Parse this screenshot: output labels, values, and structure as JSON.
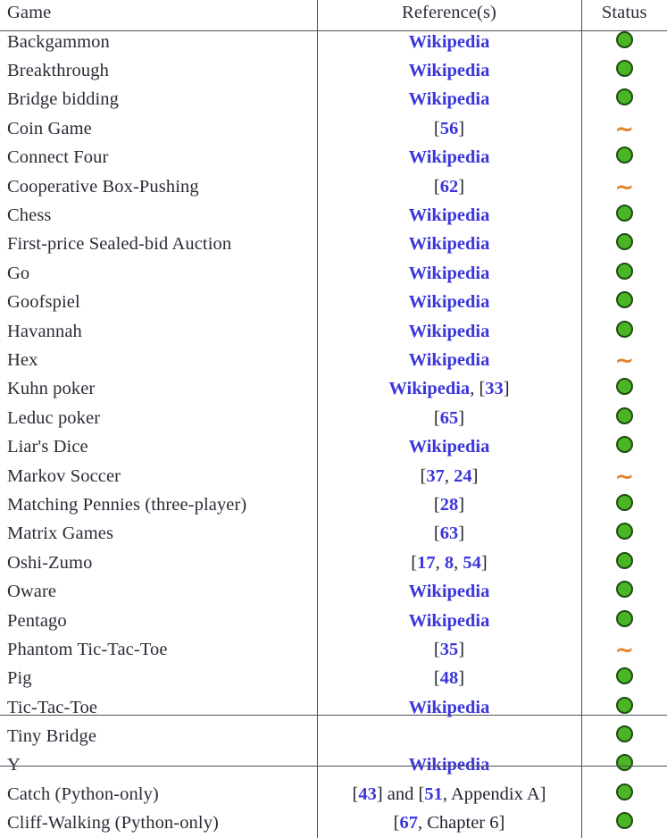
{
  "table": {
    "columns": [
      "Game",
      "Reference(s)",
      "Status"
    ],
    "status_legend": {
      "supported_icon": "green-circle-icon",
      "partial_icon": "orange-tilde-icon",
      "green_hex": "#4cb526",
      "orange_hex": "#e0862f",
      "link_hex": "#3b36d8"
    },
    "sections": [
      {
        "rows": [
          {
            "game": "Backgammon",
            "ref_parts": [
              {
                "text": "Wikipedia",
                "style": "link"
              }
            ],
            "status": "green-circle-icon"
          },
          {
            "game": "Breakthrough",
            "ref_parts": [
              {
                "text": "Wikipedia",
                "style": "link"
              }
            ],
            "status": "green-circle-icon"
          },
          {
            "game": "Bridge bidding",
            "ref_parts": [
              {
                "text": "Wikipedia",
                "style": "link"
              }
            ],
            "status": "green-circle-icon"
          },
          {
            "game": "Coin Game",
            "ref_parts": [
              {
                "text": "[",
                "style": "plain"
              },
              {
                "text": "56",
                "style": "link"
              },
              {
                "text": "]",
                "style": "plain"
              }
            ],
            "status": "orange-tilde-icon"
          },
          {
            "game": "Connect Four",
            "ref_parts": [
              {
                "text": "Wikipedia",
                "style": "link"
              }
            ],
            "status": "green-circle-icon"
          },
          {
            "game": "Cooperative Box-Pushing",
            "ref_parts": [
              {
                "text": "[",
                "style": "plain"
              },
              {
                "text": "62",
                "style": "link"
              },
              {
                "text": "]",
                "style": "plain"
              }
            ],
            "status": "orange-tilde-icon"
          },
          {
            "game": "Chess",
            "ref_parts": [
              {
                "text": "Wikipedia",
                "style": "link"
              }
            ],
            "status": "green-circle-icon"
          },
          {
            "game": "First-price Sealed-bid Auction",
            "ref_parts": [
              {
                "text": "Wikipedia",
                "style": "link"
              }
            ],
            "status": "green-circle-icon"
          },
          {
            "game": "Go",
            "ref_parts": [
              {
                "text": "Wikipedia",
                "style": "link"
              }
            ],
            "status": "green-circle-icon"
          },
          {
            "game": "Goofspiel",
            "ref_parts": [
              {
                "text": "Wikipedia",
                "style": "link"
              }
            ],
            "status": "green-circle-icon"
          },
          {
            "game": "Havannah",
            "ref_parts": [
              {
                "text": "Wikipedia",
                "style": "link"
              }
            ],
            "status": "green-circle-icon"
          },
          {
            "game": "Hex",
            "ref_parts": [
              {
                "text": "Wikipedia",
                "style": "link"
              }
            ],
            "status": "orange-tilde-icon"
          },
          {
            "game": "Kuhn poker",
            "ref_parts": [
              {
                "text": "Wikipedia",
                "style": "link"
              },
              {
                "text": ", [",
                "style": "plain"
              },
              {
                "text": "33",
                "style": "link"
              },
              {
                "text": "]",
                "style": "plain"
              }
            ],
            "status": "green-circle-icon"
          },
          {
            "game": "Leduc poker",
            "ref_parts": [
              {
                "text": "[",
                "style": "plain"
              },
              {
                "text": "65",
                "style": "link"
              },
              {
                "text": "]",
                "style": "plain"
              }
            ],
            "status": "green-circle-icon"
          },
          {
            "game": "Liar's Dice",
            "ref_parts": [
              {
                "text": "Wikipedia",
                "style": "link"
              }
            ],
            "status": "green-circle-icon"
          },
          {
            "game": "Markov Soccer",
            "ref_parts": [
              {
                "text": "[",
                "style": "plain"
              },
              {
                "text": "37",
                "style": "link"
              },
              {
                "text": ", ",
                "style": "plain"
              },
              {
                "text": "24",
                "style": "link"
              },
              {
                "text": "]",
                "style": "plain"
              }
            ],
            "status": "orange-tilde-icon"
          },
          {
            "game": "Matching Pennies (three-player)",
            "ref_parts": [
              {
                "text": "[",
                "style": "plain"
              },
              {
                "text": "28",
                "style": "link"
              },
              {
                "text": "]",
                "style": "plain"
              }
            ],
            "status": "green-circle-icon"
          },
          {
            "game": "Matrix Games",
            "ref_parts": [
              {
                "text": "[",
                "style": "plain"
              },
              {
                "text": "63",
                "style": "link"
              },
              {
                "text": "]",
                "style": "plain"
              }
            ],
            "status": "green-circle-icon"
          },
          {
            "game": "Oshi-Zumo",
            "ref_parts": [
              {
                "text": "[",
                "style": "plain"
              },
              {
                "text": "17",
                "style": "link"
              },
              {
                "text": ", ",
                "style": "plain"
              },
              {
                "text": "8",
                "style": "link"
              },
              {
                "text": ", ",
                "style": "plain"
              },
              {
                "text": "54",
                "style": "link"
              },
              {
                "text": "]",
                "style": "plain"
              }
            ],
            "status": "green-circle-icon"
          },
          {
            "game": "Oware",
            "ref_parts": [
              {
                "text": "Wikipedia",
                "style": "link"
              }
            ],
            "status": "green-circle-icon"
          },
          {
            "game": "Pentago",
            "ref_parts": [
              {
                "text": "Wikipedia",
                "style": "link"
              }
            ],
            "status": "green-circle-icon"
          },
          {
            "game": "Phantom Tic-Tac-Toe",
            "ref_parts": [
              {
                "text": "[",
                "style": "plain"
              },
              {
                "text": "35",
                "style": "link"
              },
              {
                "text": "]",
                "style": "plain"
              }
            ],
            "status": "orange-tilde-icon"
          },
          {
            "game": "Pig",
            "ref_parts": [
              {
                "text": "[",
                "style": "plain"
              },
              {
                "text": "48",
                "style": "link"
              },
              {
                "text": "]",
                "style": "plain"
              }
            ],
            "status": "green-circle-icon"
          },
          {
            "game": "Tic-Tac-Toe",
            "ref_parts": [
              {
                "text": "Wikipedia",
                "style": "link"
              }
            ],
            "status": "green-circle-icon"
          },
          {
            "game": "Tiny Bridge",
            "ref_parts": [],
            "status": "green-circle-icon"
          },
          {
            "game": "Y",
            "ref_parts": [
              {
                "text": "Wikipedia",
                "style": "link"
              }
            ],
            "status": "green-circle-icon"
          }
        ]
      },
      {
        "rows": [
          {
            "game": "Catch (Python-only)",
            "ref_parts": [
              {
                "text": "[",
                "style": "plain"
              },
              {
                "text": "43",
                "style": "link"
              },
              {
                "text": "] and [",
                "style": "plain"
              },
              {
                "text": "51",
                "style": "link"
              },
              {
                "text": ", Appendix A]",
                "style": "plain"
              }
            ],
            "status": "green-circle-icon"
          },
          {
            "game": "Cliff-Walking (Python-only)",
            "ref_parts": [
              {
                "text": "[",
                "style": "plain"
              },
              {
                "text": "67",
                "style": "link"
              },
              {
                "text": ", Chapter 6]",
                "style": "plain"
              }
            ],
            "status": "green-circle-icon"
          }
        ]
      }
    ]
  }
}
